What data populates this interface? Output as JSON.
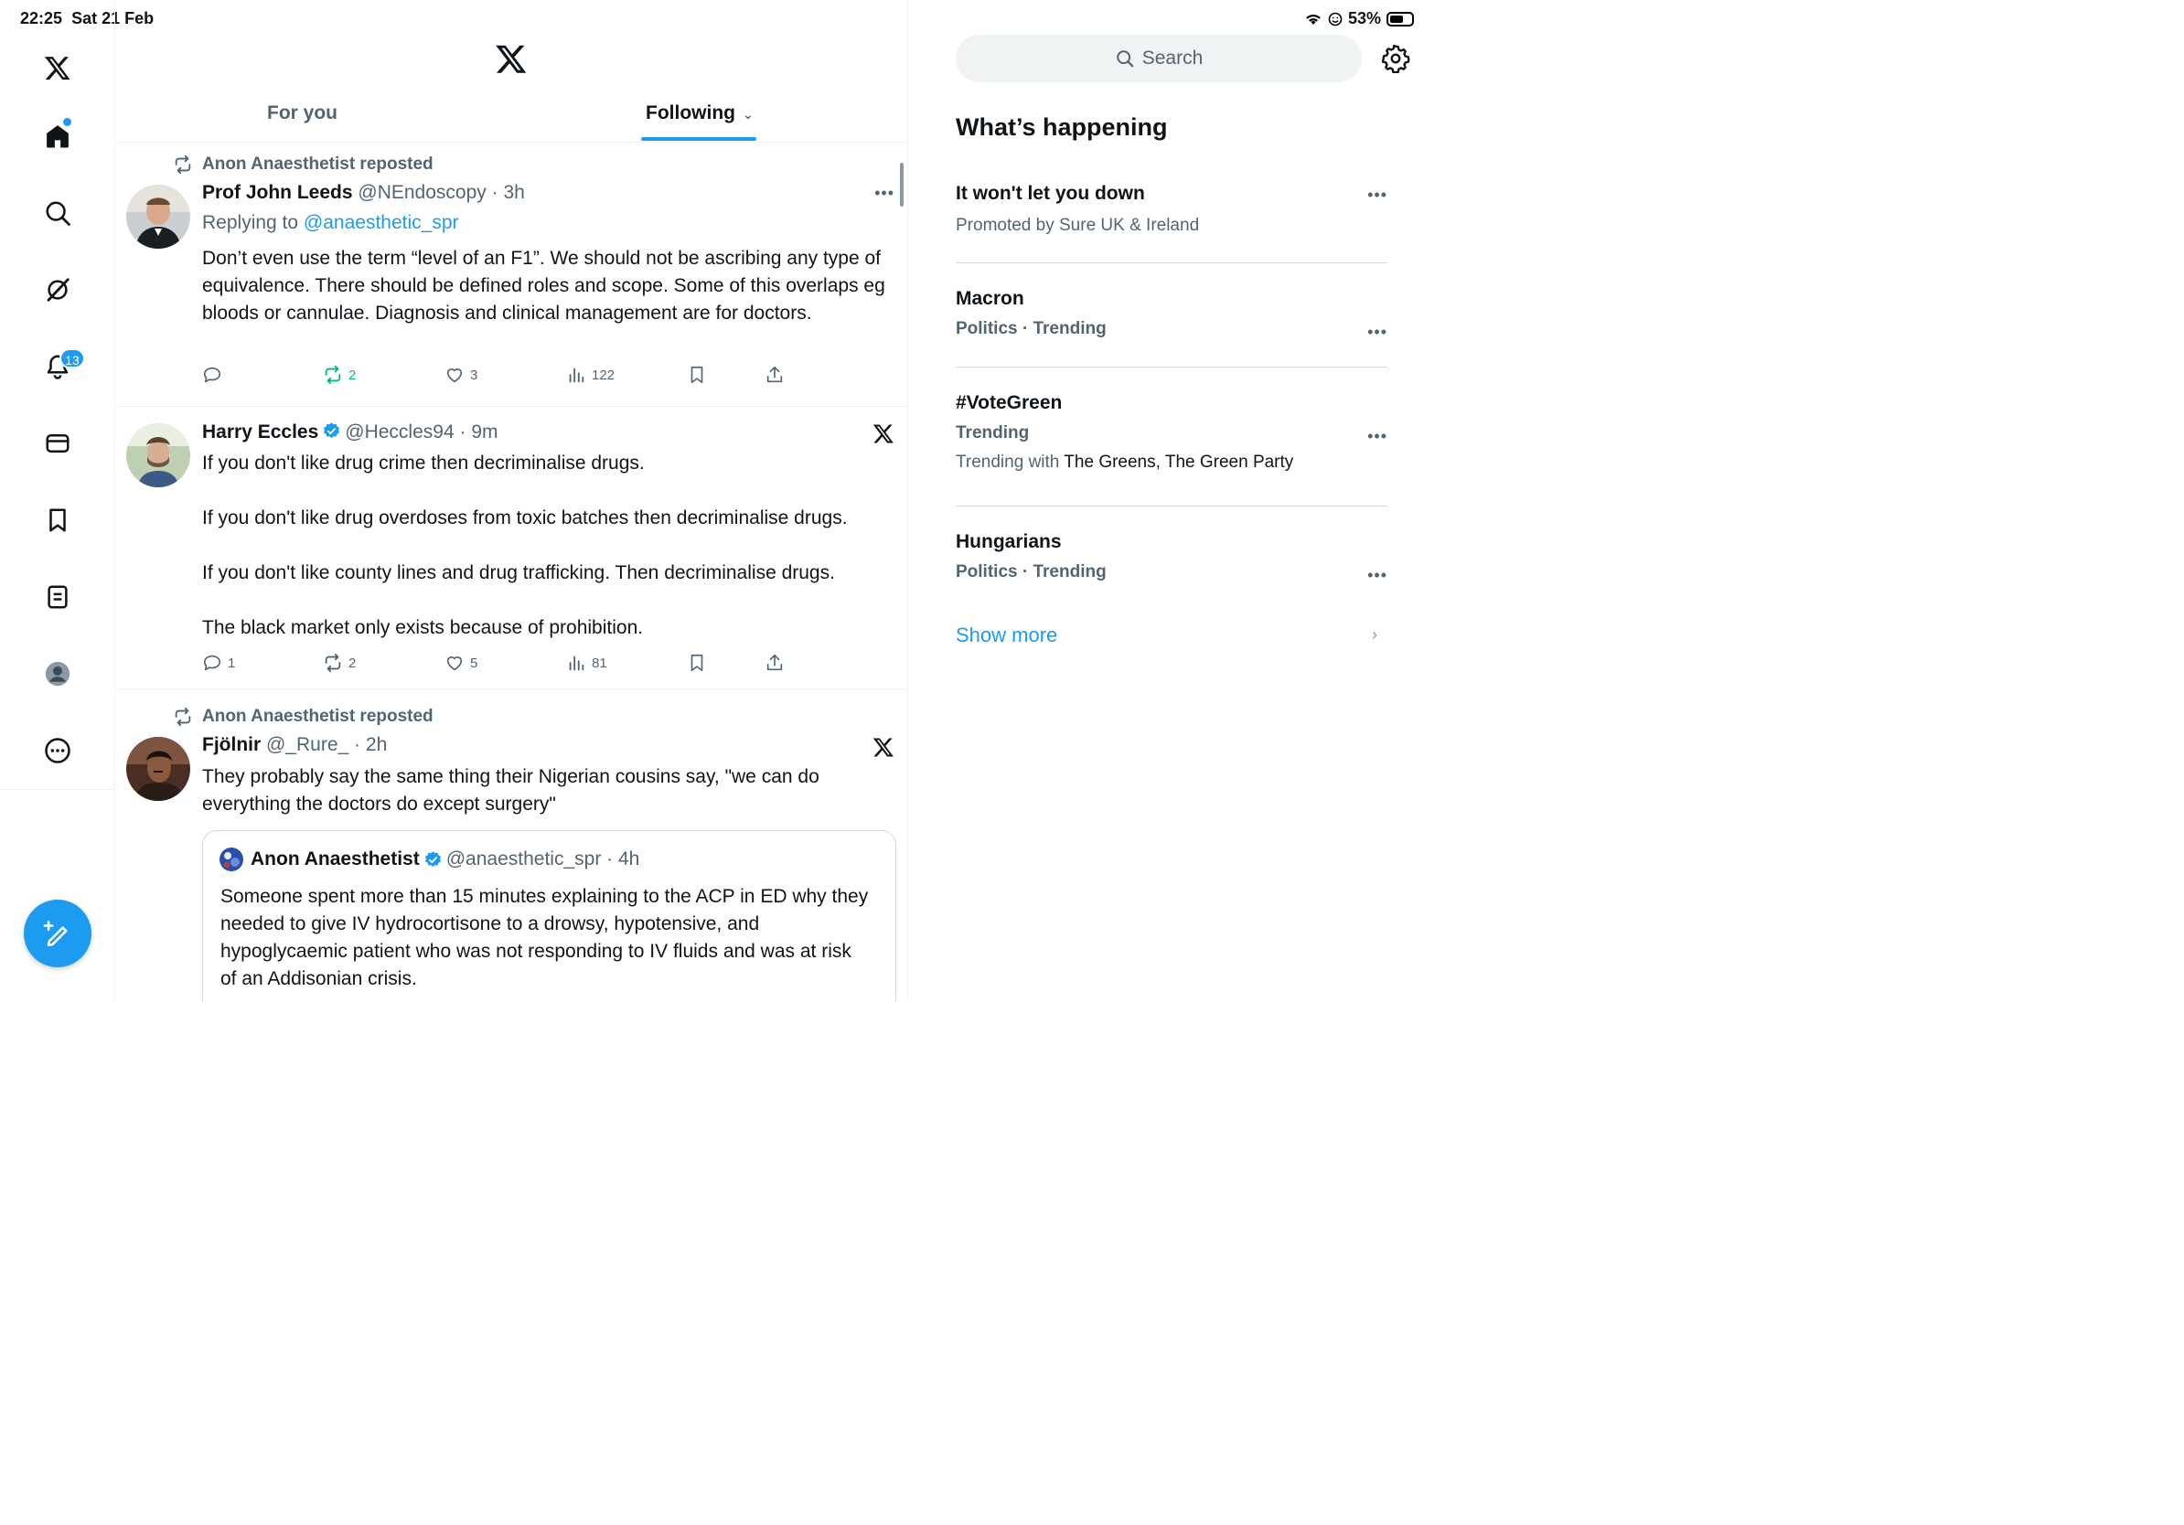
{
  "status_bar": {
    "time": "22:25",
    "date": "Sat 21 Feb",
    "battery": "53%",
    "battery_level": 0.53
  },
  "nav": {
    "notifications_badge": "13"
  },
  "tabs": {
    "for_you": "For you",
    "following": "Following"
  },
  "posts": [
    {
      "repost_by": "Anon Anaesthetist reposted",
      "author": "Prof John Leeds",
      "handle": "@NEndoscopy",
      "time": "3h",
      "replying_prefix": "Replying to ",
      "replying_to": "@anaesthetic_spr",
      "text": "Don’t even use the term “level of an F1”. We should not be ascribing any type of equivalence. There should be defined roles and scope. Some of this overlaps eg bloods or cannulae. Diagnosis and clinical management are for doctors.",
      "replies": "",
      "reposts": "2",
      "likes": "3",
      "views": "122"
    },
    {
      "author": "Harry Eccles",
      "handle": "@Heccles94",
      "time": "9m",
      "lines": [
        "If you don't like drug crime then decriminalise drugs.",
        "If you don't like drug overdoses from toxic batches then decriminalise drugs.",
        "If you don't like county lines and drug trafficking. Then decriminalise drugs.",
        "The black market only exists because of prohibition."
      ],
      "replies": "1",
      "reposts": "2",
      "likes": "5",
      "views": "81"
    },
    {
      "repost_by": "Anon Anaesthetist reposted",
      "author": "Fjölnir",
      "handle": "@_Rure_",
      "time": "2h",
      "text": "They probably say the same thing their Nigerian cousins say, \"we can do everything the doctors do except surgery\"",
      "quote": {
        "author": "Anon Anaesthetist",
        "handle": "@anaesthetic_spr",
        "time": "4h",
        "text": "Someone spent more than 15 minutes explaining to the ACP in ED why they needed to give IV hydrocortisone to a drowsy, hypotensive, and hypoglycaemic patient who was not responding to IV fluids and was at risk of an Addisonian crisis."
      }
    }
  ],
  "sidebar": {
    "search_placeholder": "Search",
    "title": "What’s happening",
    "trends": [
      {
        "title": "It won't let you down",
        "promo": "Promoted by Sure UK & Ireland"
      },
      {
        "title": "Macron",
        "meta": "Politics · Trending"
      },
      {
        "title": "#VoteGreen",
        "meta": "Trending",
        "with_prefix": "Trending with ",
        "with_names": "The Greens, The Green Party"
      },
      {
        "title": "Hungarians",
        "meta": "Politics · Trending"
      }
    ],
    "show_more": "Show more"
  },
  "colors": {
    "accent": "#1d9bf0",
    "repost_green": "#00ba7c",
    "muted": "#536471"
  },
  "icons": [
    "x-logo-icon",
    "home-icon",
    "search-icon",
    "grok-icon",
    "bell-icon",
    "mail-icon",
    "bookmark-icon",
    "list-icon",
    "avatar-icon",
    "more-icon",
    "compose-icon"
  ]
}
